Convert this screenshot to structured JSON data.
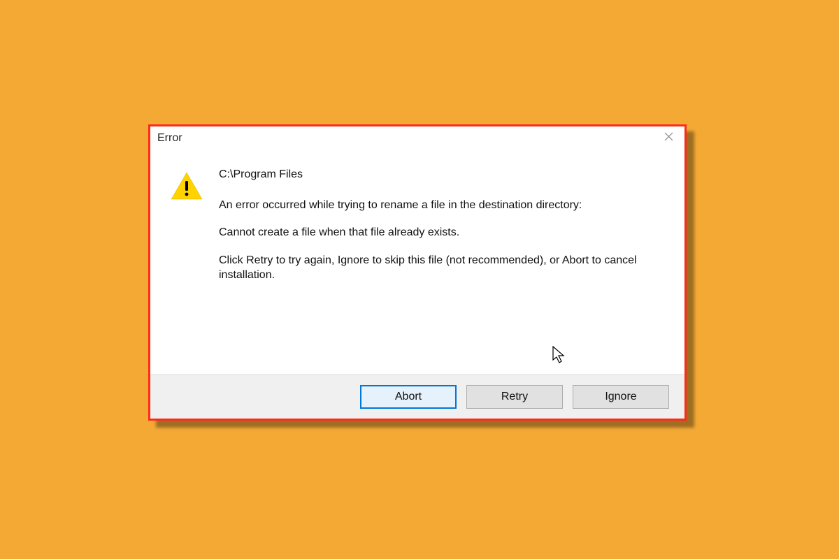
{
  "dialog": {
    "title": "Error",
    "path": "C:\\Program Files",
    "message1": "An error occurred while trying to rename a file in the destination directory:",
    "message2": "Cannot create a file when that file already exists.",
    "message3": "Click Retry to try again, Ignore to skip this file (not recommended), or Abort to cancel installation.",
    "buttons": {
      "abort": "Abort",
      "retry": "Retry",
      "ignore": "Ignore"
    }
  }
}
